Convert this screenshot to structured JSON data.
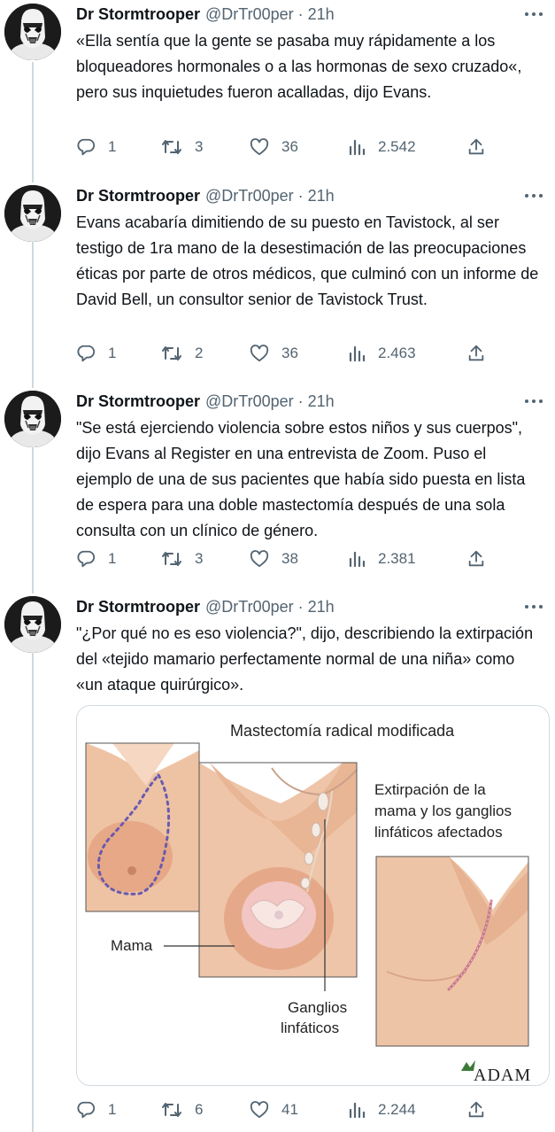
{
  "author": {
    "name": "Dr Stormtrooper",
    "handle": "@DrTr00per",
    "separator": "·"
  },
  "tweets": [
    {
      "time": "21h",
      "text": "«Ella sentía que la gente se pasaba muy rápidamente a los bloqueadores hormonales o a las hormonas de sexo cruzado«, pero sus inquietudes fueron acalladas, dijo Evans.",
      "replies": "1",
      "retweets": "3",
      "likes": "36",
      "views": "2.542"
    },
    {
      "time": "21h",
      "text": "Evans acabaría dimitiendo de su puesto en Tavistock, al ser testigo de 1ra mano de la desestimación de las preocupaciones éticas por parte de otros médicos, que culminó con un informe de David Bell, un consultor senior de Tavistock Trust.",
      "replies": "1",
      "retweets": "2",
      "likes": "36",
      "views": "2.463"
    },
    {
      "time": "21h",
      "text": "\"Se está ejerciendo violencia sobre estos niños y sus cuerpos\", dijo Evans al Register en una entrevista de Zoom. Puso el ejemplo de una de sus pacientes que había sido puesta en lista de espera para una doble mastectomía después de una sola consulta con un clínico de género.",
      "replies": "1",
      "retweets": "3",
      "likes": "38",
      "views": "2.381"
    },
    {
      "time": "21h",
      "text": "\"¿Por qué no es eso violencia?\", dijo, describiendo la extirpación del «tejido mamario perfectamente normal de una niña» como «un ataque quirúrgico».",
      "replies": "1",
      "retweets": "6",
      "likes": "41",
      "views": "2.244",
      "media": {
        "title": "Mastectomía radical modificada",
        "caption_line1": "Extirpación de la",
        "caption_line2": "mama y los ganglios",
        "caption_line3": "linfáticos afectados",
        "label_breast": "Mama",
        "label_nodes_line1": "Ganglios",
        "label_nodes_line2": "linfáticos",
        "logo": "ADAM"
      }
    }
  ],
  "icons": {
    "reply": "reply-icon",
    "retweet": "retweet-icon",
    "like": "heart-icon",
    "views": "views-icon",
    "share": "share-icon",
    "more": "more-icon"
  },
  "colors": {
    "text": "#0f1419",
    "secondary": "#536471",
    "border": "#cfd9de"
  }
}
